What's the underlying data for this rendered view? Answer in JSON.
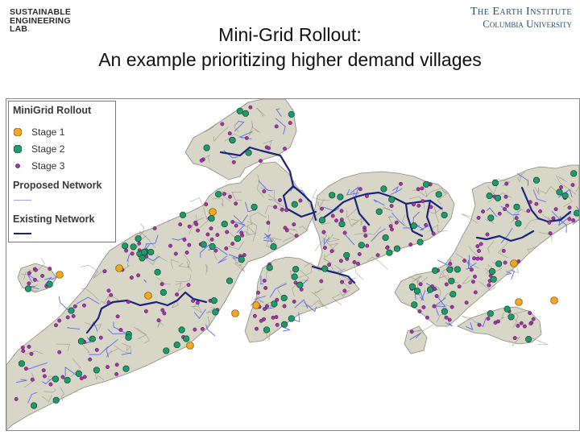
{
  "header": {
    "org_logo_lines": [
      "SUSTAINABLE",
      "ENGINEERING",
      "LAB"
    ],
    "org_logo_dot": ".",
    "institute_line1": "The Earth Institute",
    "institute_line2": "Columbia University",
    "title_line1": "Mini-Grid Rollout:",
    "title_line2": "An example prioritizing higher demand villages"
  },
  "legend": {
    "title": "MiniGrid Rollout",
    "stages": [
      {
        "label": "Stage 1",
        "color": "#f5a623",
        "icon": "octagon-marker"
      },
      {
        "label": "Stage 2",
        "color": "#1e9a6c",
        "icon": "octagon-marker"
      },
      {
        "label": "Stage 3",
        "color": "#a335a8",
        "icon": "small-dot-marker"
      }
    ],
    "proposed_label": "Proposed Network",
    "proposed_color": "#5b6cf0",
    "existing_label": "Existing Network",
    "existing_color": "#1a237e"
  },
  "map": {
    "land_color": "#d8d6c6",
    "boundary_color": "#8c8a7f",
    "background_color": "#ffffff"
  }
}
